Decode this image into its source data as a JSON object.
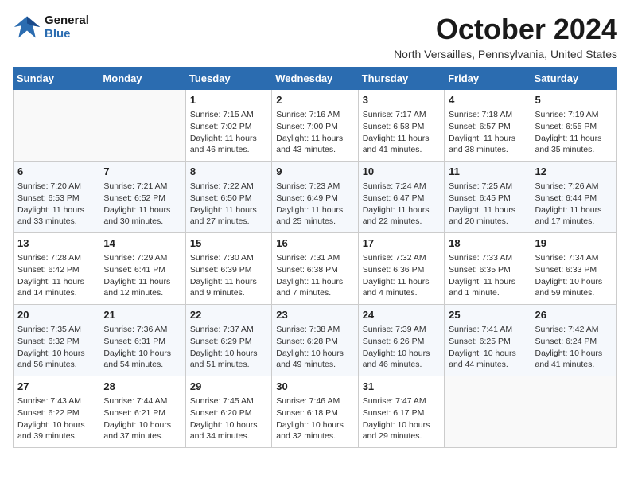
{
  "header": {
    "logo_line1": "General",
    "logo_line2": "Blue",
    "month": "October 2024",
    "location": "North Versailles, Pennsylvania, United States"
  },
  "weekdays": [
    "Sunday",
    "Monday",
    "Tuesday",
    "Wednesday",
    "Thursday",
    "Friday",
    "Saturday"
  ],
  "weeks": [
    [
      null,
      null,
      {
        "day": 1,
        "rise": "7:15 AM",
        "set": "7:02 PM",
        "daylight": "11 hours and 46 minutes."
      },
      {
        "day": 2,
        "rise": "7:16 AM",
        "set": "7:00 PM",
        "daylight": "11 hours and 43 minutes."
      },
      {
        "day": 3,
        "rise": "7:17 AM",
        "set": "6:58 PM",
        "daylight": "11 hours and 41 minutes."
      },
      {
        "day": 4,
        "rise": "7:18 AM",
        "set": "6:57 PM",
        "daylight": "11 hours and 38 minutes."
      },
      {
        "day": 5,
        "rise": "7:19 AM",
        "set": "6:55 PM",
        "daylight": "11 hours and 35 minutes."
      }
    ],
    [
      {
        "day": 6,
        "rise": "7:20 AM",
        "set": "6:53 PM",
        "daylight": "11 hours and 33 minutes."
      },
      {
        "day": 7,
        "rise": "7:21 AM",
        "set": "6:52 PM",
        "daylight": "11 hours and 30 minutes."
      },
      {
        "day": 8,
        "rise": "7:22 AM",
        "set": "6:50 PM",
        "daylight": "11 hours and 27 minutes."
      },
      {
        "day": 9,
        "rise": "7:23 AM",
        "set": "6:49 PM",
        "daylight": "11 hours and 25 minutes."
      },
      {
        "day": 10,
        "rise": "7:24 AM",
        "set": "6:47 PM",
        "daylight": "11 hours and 22 minutes."
      },
      {
        "day": 11,
        "rise": "7:25 AM",
        "set": "6:45 PM",
        "daylight": "11 hours and 20 minutes."
      },
      {
        "day": 12,
        "rise": "7:26 AM",
        "set": "6:44 PM",
        "daylight": "11 hours and 17 minutes."
      }
    ],
    [
      {
        "day": 13,
        "rise": "7:28 AM",
        "set": "6:42 PM",
        "daylight": "11 hours and 14 minutes."
      },
      {
        "day": 14,
        "rise": "7:29 AM",
        "set": "6:41 PM",
        "daylight": "11 hours and 12 minutes."
      },
      {
        "day": 15,
        "rise": "7:30 AM",
        "set": "6:39 PM",
        "daylight": "11 hours and 9 minutes."
      },
      {
        "day": 16,
        "rise": "7:31 AM",
        "set": "6:38 PM",
        "daylight": "11 hours and 7 minutes."
      },
      {
        "day": 17,
        "rise": "7:32 AM",
        "set": "6:36 PM",
        "daylight": "11 hours and 4 minutes."
      },
      {
        "day": 18,
        "rise": "7:33 AM",
        "set": "6:35 PM",
        "daylight": "11 hours and 1 minute."
      },
      {
        "day": 19,
        "rise": "7:34 AM",
        "set": "6:33 PM",
        "daylight": "10 hours and 59 minutes."
      }
    ],
    [
      {
        "day": 20,
        "rise": "7:35 AM",
        "set": "6:32 PM",
        "daylight": "10 hours and 56 minutes."
      },
      {
        "day": 21,
        "rise": "7:36 AM",
        "set": "6:31 PM",
        "daylight": "10 hours and 54 minutes."
      },
      {
        "day": 22,
        "rise": "7:37 AM",
        "set": "6:29 PM",
        "daylight": "10 hours and 51 minutes."
      },
      {
        "day": 23,
        "rise": "7:38 AM",
        "set": "6:28 PM",
        "daylight": "10 hours and 49 minutes."
      },
      {
        "day": 24,
        "rise": "7:39 AM",
        "set": "6:26 PM",
        "daylight": "10 hours and 46 minutes."
      },
      {
        "day": 25,
        "rise": "7:41 AM",
        "set": "6:25 PM",
        "daylight": "10 hours and 44 minutes."
      },
      {
        "day": 26,
        "rise": "7:42 AM",
        "set": "6:24 PM",
        "daylight": "10 hours and 41 minutes."
      }
    ],
    [
      {
        "day": 27,
        "rise": "7:43 AM",
        "set": "6:22 PM",
        "daylight": "10 hours and 39 minutes."
      },
      {
        "day": 28,
        "rise": "7:44 AM",
        "set": "6:21 PM",
        "daylight": "10 hours and 37 minutes."
      },
      {
        "day": 29,
        "rise": "7:45 AM",
        "set": "6:20 PM",
        "daylight": "10 hours and 34 minutes."
      },
      {
        "day": 30,
        "rise": "7:46 AM",
        "set": "6:18 PM",
        "daylight": "10 hours and 32 minutes."
      },
      {
        "day": 31,
        "rise": "7:47 AM",
        "set": "6:17 PM",
        "daylight": "10 hours and 29 minutes."
      },
      null,
      null
    ]
  ]
}
